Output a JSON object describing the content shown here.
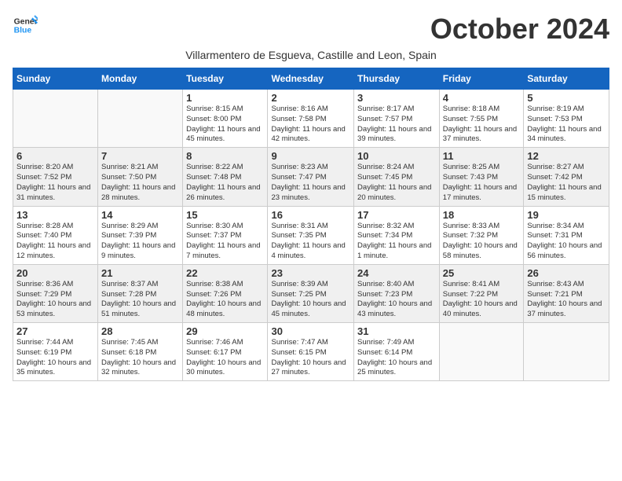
{
  "logo": {
    "line1": "General",
    "line2": "Blue"
  },
  "title": "October 2024",
  "subtitle": "Villarmentero de Esgueva, Castille and Leon, Spain",
  "days_of_week": [
    "Sunday",
    "Monday",
    "Tuesday",
    "Wednesday",
    "Thursday",
    "Friday",
    "Saturday"
  ],
  "weeks": [
    [
      {
        "day": "",
        "sunrise": "",
        "sunset": "",
        "daylight": ""
      },
      {
        "day": "",
        "sunrise": "",
        "sunset": "",
        "daylight": ""
      },
      {
        "day": "1",
        "sunrise": "Sunrise: 8:15 AM",
        "sunset": "Sunset: 8:00 PM",
        "daylight": "Daylight: 11 hours and 45 minutes."
      },
      {
        "day": "2",
        "sunrise": "Sunrise: 8:16 AM",
        "sunset": "Sunset: 7:58 PM",
        "daylight": "Daylight: 11 hours and 42 minutes."
      },
      {
        "day": "3",
        "sunrise": "Sunrise: 8:17 AM",
        "sunset": "Sunset: 7:57 PM",
        "daylight": "Daylight: 11 hours and 39 minutes."
      },
      {
        "day": "4",
        "sunrise": "Sunrise: 8:18 AM",
        "sunset": "Sunset: 7:55 PM",
        "daylight": "Daylight: 11 hours and 37 minutes."
      },
      {
        "day": "5",
        "sunrise": "Sunrise: 8:19 AM",
        "sunset": "Sunset: 7:53 PM",
        "daylight": "Daylight: 11 hours and 34 minutes."
      }
    ],
    [
      {
        "day": "6",
        "sunrise": "Sunrise: 8:20 AM",
        "sunset": "Sunset: 7:52 PM",
        "daylight": "Daylight: 11 hours and 31 minutes."
      },
      {
        "day": "7",
        "sunrise": "Sunrise: 8:21 AM",
        "sunset": "Sunset: 7:50 PM",
        "daylight": "Daylight: 11 hours and 28 minutes."
      },
      {
        "day": "8",
        "sunrise": "Sunrise: 8:22 AM",
        "sunset": "Sunset: 7:48 PM",
        "daylight": "Daylight: 11 hours and 26 minutes."
      },
      {
        "day": "9",
        "sunrise": "Sunrise: 8:23 AM",
        "sunset": "Sunset: 7:47 PM",
        "daylight": "Daylight: 11 hours and 23 minutes."
      },
      {
        "day": "10",
        "sunrise": "Sunrise: 8:24 AM",
        "sunset": "Sunset: 7:45 PM",
        "daylight": "Daylight: 11 hours and 20 minutes."
      },
      {
        "day": "11",
        "sunrise": "Sunrise: 8:25 AM",
        "sunset": "Sunset: 7:43 PM",
        "daylight": "Daylight: 11 hours and 17 minutes."
      },
      {
        "day": "12",
        "sunrise": "Sunrise: 8:27 AM",
        "sunset": "Sunset: 7:42 PM",
        "daylight": "Daylight: 11 hours and 15 minutes."
      }
    ],
    [
      {
        "day": "13",
        "sunrise": "Sunrise: 8:28 AM",
        "sunset": "Sunset: 7:40 PM",
        "daylight": "Daylight: 11 hours and 12 minutes."
      },
      {
        "day": "14",
        "sunrise": "Sunrise: 8:29 AM",
        "sunset": "Sunset: 7:39 PM",
        "daylight": "Daylight: 11 hours and 9 minutes."
      },
      {
        "day": "15",
        "sunrise": "Sunrise: 8:30 AM",
        "sunset": "Sunset: 7:37 PM",
        "daylight": "Daylight: 11 hours and 7 minutes."
      },
      {
        "day": "16",
        "sunrise": "Sunrise: 8:31 AM",
        "sunset": "Sunset: 7:35 PM",
        "daylight": "Daylight: 11 hours and 4 minutes."
      },
      {
        "day": "17",
        "sunrise": "Sunrise: 8:32 AM",
        "sunset": "Sunset: 7:34 PM",
        "daylight": "Daylight: 11 hours and 1 minute."
      },
      {
        "day": "18",
        "sunrise": "Sunrise: 8:33 AM",
        "sunset": "Sunset: 7:32 PM",
        "daylight": "Daylight: 10 hours and 58 minutes."
      },
      {
        "day": "19",
        "sunrise": "Sunrise: 8:34 AM",
        "sunset": "Sunset: 7:31 PM",
        "daylight": "Daylight: 10 hours and 56 minutes."
      }
    ],
    [
      {
        "day": "20",
        "sunrise": "Sunrise: 8:36 AM",
        "sunset": "Sunset: 7:29 PM",
        "daylight": "Daylight: 10 hours and 53 minutes."
      },
      {
        "day": "21",
        "sunrise": "Sunrise: 8:37 AM",
        "sunset": "Sunset: 7:28 PM",
        "daylight": "Daylight: 10 hours and 51 minutes."
      },
      {
        "day": "22",
        "sunrise": "Sunrise: 8:38 AM",
        "sunset": "Sunset: 7:26 PM",
        "daylight": "Daylight: 10 hours and 48 minutes."
      },
      {
        "day": "23",
        "sunrise": "Sunrise: 8:39 AM",
        "sunset": "Sunset: 7:25 PM",
        "daylight": "Daylight: 10 hours and 45 minutes."
      },
      {
        "day": "24",
        "sunrise": "Sunrise: 8:40 AM",
        "sunset": "Sunset: 7:23 PM",
        "daylight": "Daylight: 10 hours and 43 minutes."
      },
      {
        "day": "25",
        "sunrise": "Sunrise: 8:41 AM",
        "sunset": "Sunset: 7:22 PM",
        "daylight": "Daylight: 10 hours and 40 minutes."
      },
      {
        "day": "26",
        "sunrise": "Sunrise: 8:43 AM",
        "sunset": "Sunset: 7:21 PM",
        "daylight": "Daylight: 10 hours and 37 minutes."
      }
    ],
    [
      {
        "day": "27",
        "sunrise": "Sunrise: 7:44 AM",
        "sunset": "Sunset: 6:19 PM",
        "daylight": "Daylight: 10 hours and 35 minutes."
      },
      {
        "day": "28",
        "sunrise": "Sunrise: 7:45 AM",
        "sunset": "Sunset: 6:18 PM",
        "daylight": "Daylight: 10 hours and 32 minutes."
      },
      {
        "day": "29",
        "sunrise": "Sunrise: 7:46 AM",
        "sunset": "Sunset: 6:17 PM",
        "daylight": "Daylight: 10 hours and 30 minutes."
      },
      {
        "day": "30",
        "sunrise": "Sunrise: 7:47 AM",
        "sunset": "Sunset: 6:15 PM",
        "daylight": "Daylight: 10 hours and 27 minutes."
      },
      {
        "day": "31",
        "sunrise": "Sunrise: 7:49 AM",
        "sunset": "Sunset: 6:14 PM",
        "daylight": "Daylight: 10 hours and 25 minutes."
      },
      {
        "day": "",
        "sunrise": "",
        "sunset": "",
        "daylight": ""
      },
      {
        "day": "",
        "sunrise": "",
        "sunset": "",
        "daylight": ""
      }
    ]
  ]
}
